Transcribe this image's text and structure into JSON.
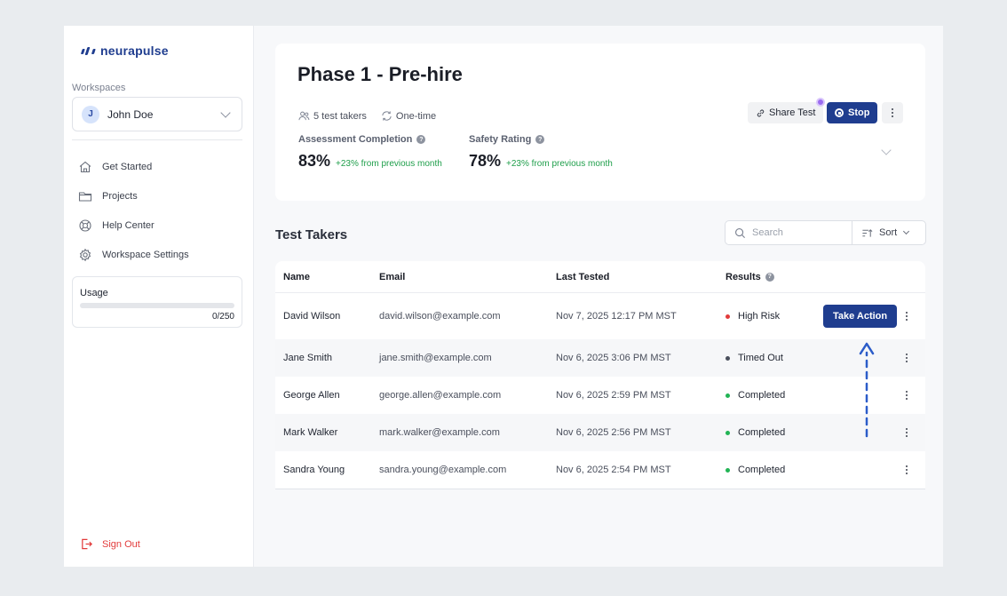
{
  "brand": {
    "name": "neurapulse",
    "color": "#1f3d8f"
  },
  "sidebar": {
    "workspaces_label": "Workspaces",
    "workspace": {
      "initial": "J",
      "name": "John Doe"
    },
    "nav": [
      {
        "label": "Get Started",
        "icon": "home-icon"
      },
      {
        "label": "Projects",
        "icon": "folder-icon"
      },
      {
        "label": "Help Center",
        "icon": "lifebuoy-icon"
      },
      {
        "label": "Workspace Settings",
        "icon": "gear-icon"
      }
    ],
    "usage": {
      "title": "Usage",
      "count": "0/250",
      "used": 0,
      "limit": 250
    },
    "signout_label": "Sign Out"
  },
  "test": {
    "title": "Phase 1 - Pre-hire",
    "takers": "5 test takers",
    "frequency": "One-time",
    "stats": [
      {
        "label": "Assessment Completion",
        "value": "83%",
        "delta": "+23% from previous month"
      },
      {
        "label": "Safety Rating",
        "value": "78%",
        "delta": "+23% from previous month"
      }
    ],
    "share_label": "Share Test",
    "stop_label": "Stop"
  },
  "takers_section": {
    "title": "Test Takers",
    "search_placeholder": "Search",
    "sort_label": "Sort",
    "columns": {
      "name": "Name",
      "email": "Email",
      "last_tested": "Last Tested",
      "results": "Results"
    },
    "action_label": "Take Action",
    "rows": [
      {
        "name": "David Wilson",
        "email": "david.wilson@example.com",
        "date": "Nov 7, 2025 12:17 PM MST",
        "result": "High Risk",
        "status_color": "#e23b3b"
      },
      {
        "name": "Jane Smith",
        "email": "jane.smith@example.com",
        "date": "Nov 6, 2025 3:06 PM MST",
        "result": "Timed Out",
        "status_color": "#4a4f5c"
      },
      {
        "name": "George Allen",
        "email": "george.allen@example.com",
        "date": "Nov 6, 2025 2:59 PM MST",
        "result": "Completed",
        "status_color": "#22b455"
      },
      {
        "name": "Mark Walker",
        "email": "mark.walker@example.com",
        "date": "Nov 6, 2025 2:56 PM MST",
        "result": "Completed",
        "status_color": "#22b455"
      },
      {
        "name": "Sandra Young",
        "email": "sandra.young@example.com",
        "date": "Nov 6, 2025 2:54 PM MST",
        "result": "Completed",
        "status_color": "#22b455"
      }
    ]
  }
}
